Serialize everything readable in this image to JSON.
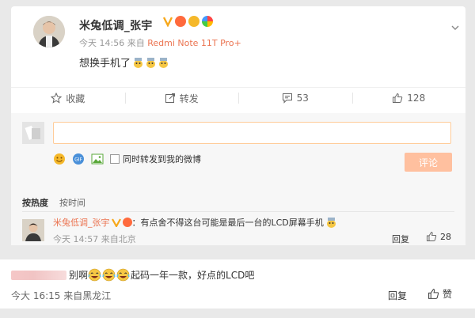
{
  "post": {
    "author": "米兔低调_张宇",
    "time": "今天 14:56",
    "source_prefix": "来自",
    "device": "Redmi Note 11T Pro+",
    "content": "想换手机了"
  },
  "actions": {
    "favorite": "收藏",
    "repost": "转发",
    "comment_count": "53",
    "like_count": "128"
  },
  "composer": {
    "input_value": "",
    "repost_checkbox_label": "同时转发到我的微博",
    "submit_label": "评论"
  },
  "sort": {
    "hot": "按热度",
    "time": "按时间"
  },
  "comment": {
    "user": "米兔低调_张宇",
    "separator": "：",
    "text": "有点舍不得这台可能是最后一台的LCD屏幕手机",
    "time": "今天 14:57 来自北京",
    "reply_label": "回复",
    "likes": "28"
  },
  "bottom_comment": {
    "text_start": "别啊",
    "text_end": "起码一年一款，好点的LCD吧",
    "time": "今大 16:15 来自黑龙江",
    "reply_label": "回复",
    "like_label": "赞"
  },
  "colors": {
    "accent": "#eb7350",
    "submit_bg": "#ffc09f",
    "input_border": "#ffcc99"
  },
  "icons": [
    "chevron-down-icon",
    "star-icon",
    "repost-icon",
    "comment-icon",
    "thumbs-up-icon",
    "emoji-icon",
    "image-icon",
    "crying-emoji-icon",
    "laughing-emoji-icon"
  ]
}
